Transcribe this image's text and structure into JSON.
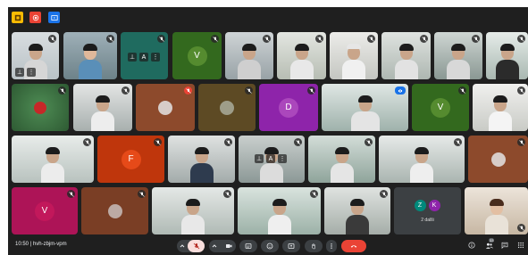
{
  "meeting": {
    "time": "10:50",
    "separator": "|",
    "code": "hvh-zbjm-vpm",
    "participants_count": "33"
  },
  "tiles": {
    "v1": "V",
    "d1": "D",
    "v2": "V",
    "f1": "F",
    "v3": "V",
    "z1": "Z",
    "k1": "K",
    "group_label": "2 dalši"
  },
  "colors": {
    "background": "#1f1f1f",
    "leave_button": "#ea4335",
    "avatar_green": "#33691e",
    "avatar_purple": "#8e24aa",
    "avatar_orange": "#e65100",
    "avatar_magenta": "#ad1457",
    "avatar_teal": "#00897b"
  }
}
